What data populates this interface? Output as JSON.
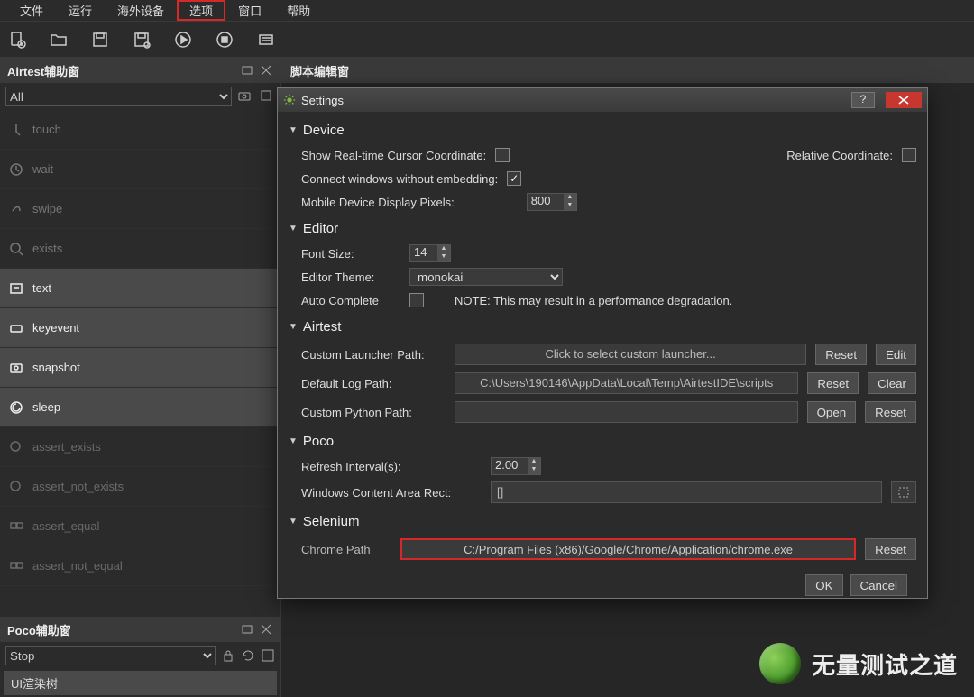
{
  "menu": {
    "file": "文件",
    "run": "运行",
    "device": "海外设备",
    "options": "选项",
    "window": "窗口",
    "help": "帮助"
  },
  "panels": {
    "airtest": "Airtest辅助窗",
    "script": "脚本编辑窗",
    "poco": "Poco辅助窗"
  },
  "airtest": {
    "filter": "All",
    "items": [
      {
        "label": "touch"
      },
      {
        "label": "wait"
      },
      {
        "label": "swipe"
      },
      {
        "label": "exists"
      },
      {
        "label": "text"
      },
      {
        "label": "keyevent"
      },
      {
        "label": "snapshot"
      },
      {
        "label": "sleep"
      },
      {
        "label": "assert_exists"
      },
      {
        "label": "assert_not_exists"
      },
      {
        "label": "assert_equal"
      },
      {
        "label": "assert_not_equal"
      }
    ]
  },
  "poco": {
    "mode": "Stop",
    "tree": "UI渲染树"
  },
  "dlg": {
    "title": "Settings",
    "device": {
      "head": "Device",
      "realtime": "Show Real-time Cursor Coordinate:",
      "relative": "Relative Coordinate:",
      "embed": "Connect windows without embedding:",
      "pixels": "Mobile Device Display Pixels:",
      "pixels_val": "800"
    },
    "editor": {
      "head": "Editor",
      "font": "Font Size:",
      "font_val": "14",
      "theme": "Editor Theme:",
      "theme_val": "monokai",
      "auto": "Auto Complete",
      "note": "NOTE: This may result in a performance degradation."
    },
    "air": {
      "head": "Airtest",
      "launcher": "Custom Launcher Path:",
      "launcher_ph": "Click to select custom launcher...",
      "log": "Default Log Path:",
      "log_val": "C:\\Users\\190146\\AppData\\Local\\Temp\\AirtestIDE\\scripts",
      "python": "Custom Python Path:",
      "reset": "Reset",
      "edit": "Edit",
      "clear": "Clear",
      "open": "Open"
    },
    "poco": {
      "head": "Poco",
      "refresh": "Refresh Interval(s):",
      "refresh_val": "2.00",
      "rect": "Windows Content Area Rect:",
      "rect_val": "[]"
    },
    "sel": {
      "head": "Selenium",
      "chrome": "Chrome Path",
      "chrome_val": "C:/Program Files (x86)/Google/Chrome/Application/chrome.exe",
      "reset": "Reset"
    },
    "footer": {
      "ok": "OK",
      "cancel": "Cancel"
    }
  },
  "watermark": "无量测试之道"
}
